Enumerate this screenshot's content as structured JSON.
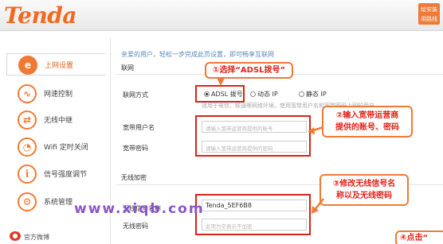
{
  "header": {
    "logo_text": "Tenda",
    "badge_line1": "给安装",
    "badge_line2": "用路线"
  },
  "sidebar": {
    "items": [
      {
        "label": "上网设置",
        "icon": "e-globe-icon",
        "active": true
      },
      {
        "label": "网速控制",
        "icon": "bandwidth-wave-icon",
        "active": false
      },
      {
        "label": "无线中继",
        "icon": "wifi-relay-icon",
        "active": false
      },
      {
        "label": "Wifi 定时关闭",
        "icon": "wifi-timer-icon",
        "active": false
      },
      {
        "label": "信号强度调节",
        "icon": "signal-strength-icon",
        "active": false
      },
      {
        "label": "系统管理",
        "icon": "gear-icon",
        "active": false
      }
    ],
    "weibo_label": "官方微博"
  },
  "content": {
    "greeting": "亲爱的用户，轻松一步完成此页设置，即可畅享互联网",
    "section_internet": "联网",
    "connection_label": "联网方式",
    "connection_options": [
      "ADSL 拨号",
      "动态 IP",
      "静态 IP"
    ],
    "selected_option": "ADSL 拨号",
    "note": "适用于电信、联通等网络环境，使用宽带用户名和宽带密码上网的用户",
    "username_label": "宽带用户名",
    "username_placeholder": "请输入宽带运营商提供的账号",
    "password_label": "宽带密码",
    "password_placeholder": "请输入宽带运营商提供的密码",
    "section_wireless": "无线加密",
    "ssid_label": "无线信号名称",
    "ssid_value": "Tenda_5EF6B8",
    "wifi_password_label": "无线密码",
    "wifi_password_placeholder": "此项为空表示不加密"
  },
  "annotations": {
    "step1": "①选择“ADSL拨号”",
    "step2_line1": "②输入宽带运营商",
    "step2_line2": "提供的账号、密码",
    "step3_line1": "③修改无线信号名",
    "step3_line2": "称以及无线密码",
    "step4": "④点击“"
  },
  "watermark": "www.xiqb.com",
  "colors": {
    "brand_orange": "#f07a35",
    "annotation_red": "#d7241c",
    "greeting_blue": "#5b8bb6"
  }
}
